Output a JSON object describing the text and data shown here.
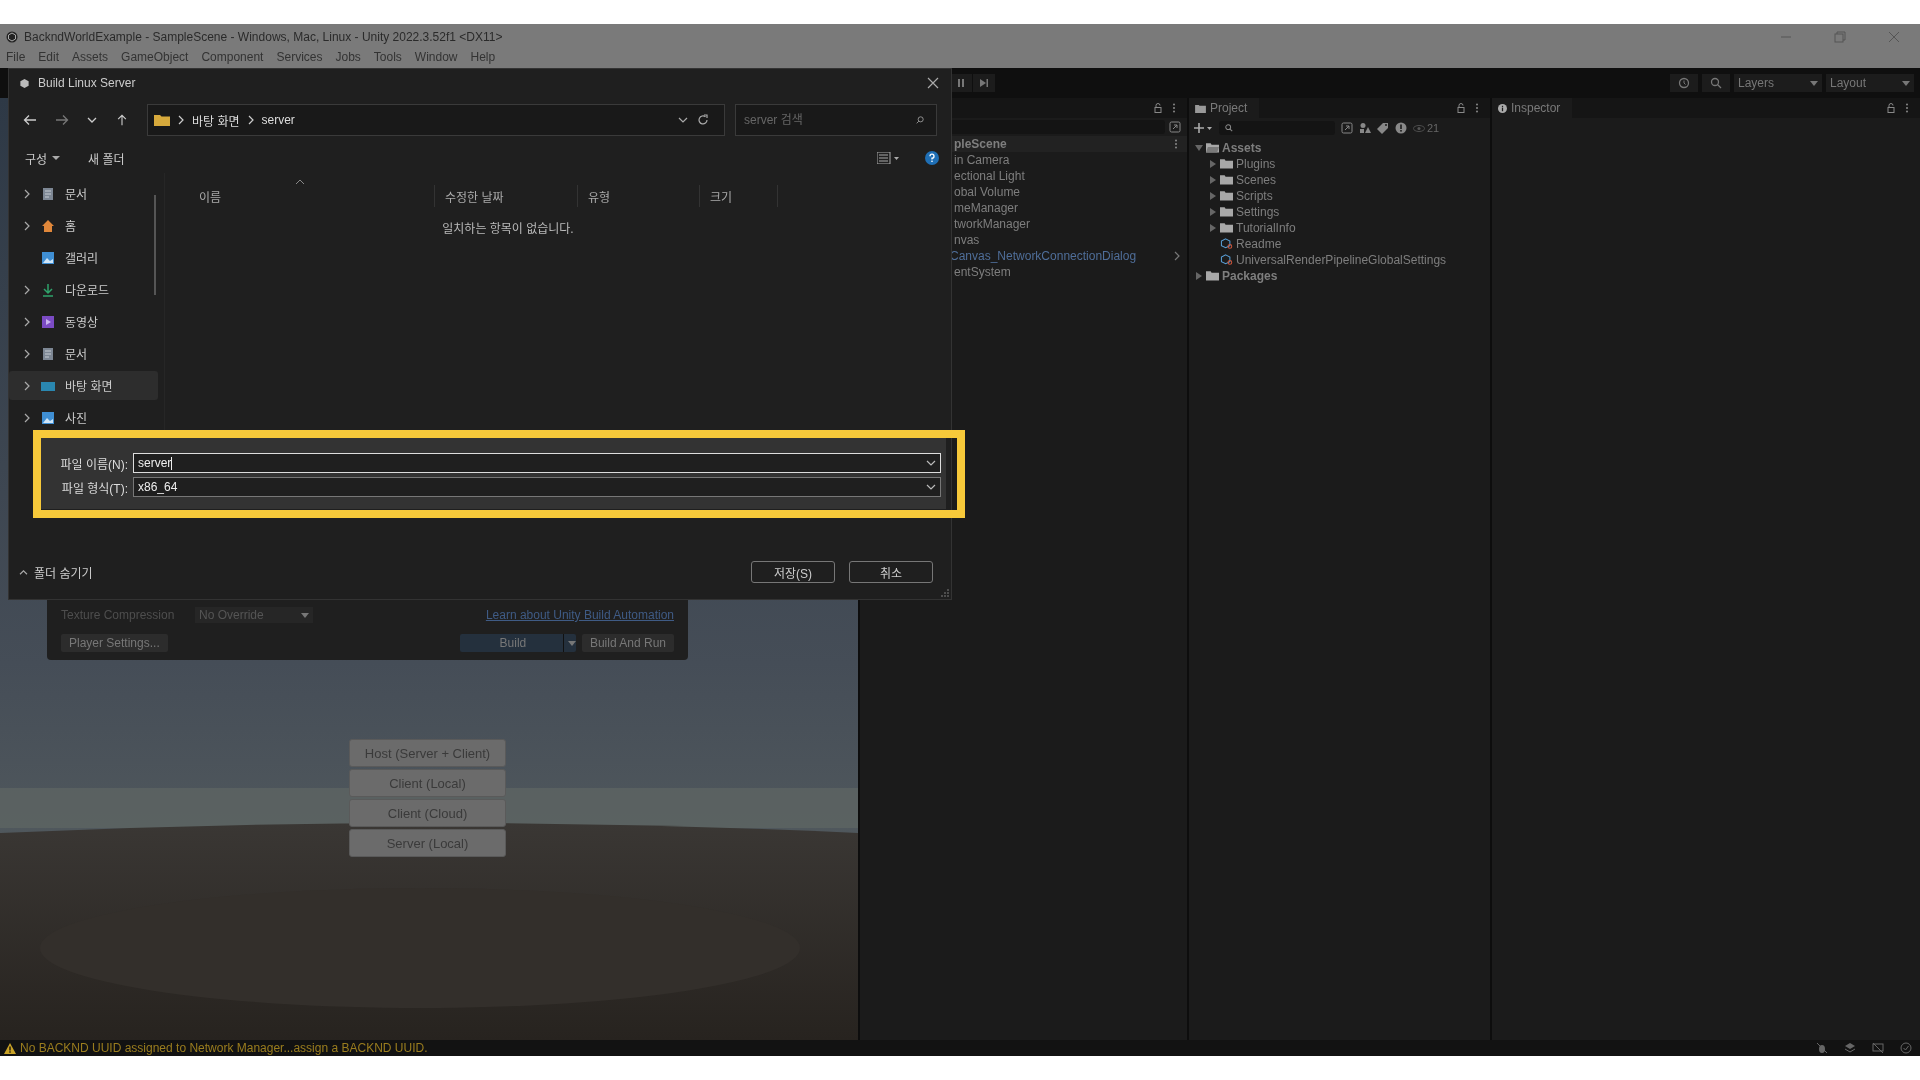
{
  "window": {
    "title": "BackndWorldExample - SampleScene - Windows, Mac, Linux - Unity 2022.3.52f1 <DX11>",
    "menu": [
      "File",
      "Edit",
      "Assets",
      "GameObject",
      "Component",
      "Services",
      "Jobs",
      "Tools",
      "Window",
      "Help"
    ]
  },
  "toolbar": {
    "layers": "Layers",
    "layout": "Layout"
  },
  "hierarchy": {
    "items": [
      {
        "label": "pleScene",
        "kind": "scene"
      },
      {
        "label": "in Camera",
        "kind": "object"
      },
      {
        "label": "ectional Light",
        "kind": "object"
      },
      {
        "label": "obal Volume",
        "kind": "object"
      },
      {
        "label": "meManager",
        "kind": "object"
      },
      {
        "label": "tworkManager",
        "kind": "object"
      },
      {
        "label": "nvas",
        "kind": "object",
        "children": [
          {
            "label": "Canvas_NetworkConnectionDialog",
            "kind": "prefab"
          }
        ]
      },
      {
        "label": "entSystem",
        "kind": "object"
      }
    ]
  },
  "project": {
    "tab": "Project",
    "count": "21",
    "tree": [
      {
        "label": "Assets",
        "kind": "folder",
        "expanded": true,
        "children": [
          {
            "label": "Plugins",
            "kind": "folder",
            "expanded": false
          },
          {
            "label": "Scenes",
            "kind": "folder",
            "expanded": false
          },
          {
            "label": "Scripts",
            "kind": "folder",
            "expanded": false
          },
          {
            "label": "Settings",
            "kind": "folder",
            "expanded": false
          },
          {
            "label": "TutorialInfo",
            "kind": "folder",
            "expanded": false
          },
          {
            "label": "Readme",
            "kind": "asset"
          },
          {
            "label": "UniversalRenderPipelineGlobalSettings",
            "kind": "asset"
          }
        ]
      },
      {
        "label": "Packages",
        "kind": "folder",
        "expanded": false
      }
    ]
  },
  "inspector": {
    "tab": "Inspector"
  },
  "build_settings": {
    "texture_compression_label": "Texture Compression",
    "texture_compression": "No Override",
    "link": "Learn about Unity Build Automation",
    "player_settings": "Player Settings...",
    "build": "Build",
    "build_and_run": "Build And Run"
  },
  "game_view": {
    "buttons": [
      "Host (Server + Client)",
      "Client (Local)",
      "Client (Cloud)",
      "Server (Local)"
    ]
  },
  "dialog": {
    "title": "Build Linux Server",
    "path": [
      "바탕 화면",
      "server"
    ],
    "search": {
      "placeholder": "server 검색"
    },
    "organize": "구성",
    "new_folder": "새 폴더",
    "nav": [
      {
        "label": "문서",
        "kind": "documents",
        "expandable": true,
        "selected": false
      },
      {
        "label": "홈",
        "kind": "home",
        "expandable": true,
        "selected": false
      },
      {
        "label": "갤러리",
        "kind": "gallery",
        "expandable": false,
        "selected": false
      },
      {
        "label": "다운로드",
        "kind": "downloads",
        "expandable": true,
        "selected": false
      },
      {
        "label": "동영상",
        "kind": "videos",
        "expandable": true,
        "selected": false
      },
      {
        "label": "문서",
        "kind": "documents",
        "expandable": true,
        "selected": false
      },
      {
        "label": "바탕 화면",
        "kind": "desktop",
        "expandable": true,
        "selected": true
      },
      {
        "label": "사진",
        "kind": "pictures",
        "expandable": true,
        "selected": false
      }
    ],
    "columns": [
      {
        "label": "이름",
        "sorted": true
      },
      {
        "label": "수정한 날짜",
        "sorted": false
      },
      {
        "label": "유형",
        "sorted": false
      },
      {
        "label": "크기",
        "sorted": false
      }
    ],
    "empty_message": "일치하는 항목이 없습니다.",
    "file_name_label": "파일 이름(N):",
    "file_name": "server",
    "file_type_label": "파일 형식(T):",
    "file_type": "x86_64",
    "hide_folders": "폴더 숨기기",
    "save": "저장(S)",
    "cancel": "취소"
  },
  "status_bar": {
    "message": "No BACKND UUID assigned to Network Manager...assign a BACKND UUID."
  }
}
